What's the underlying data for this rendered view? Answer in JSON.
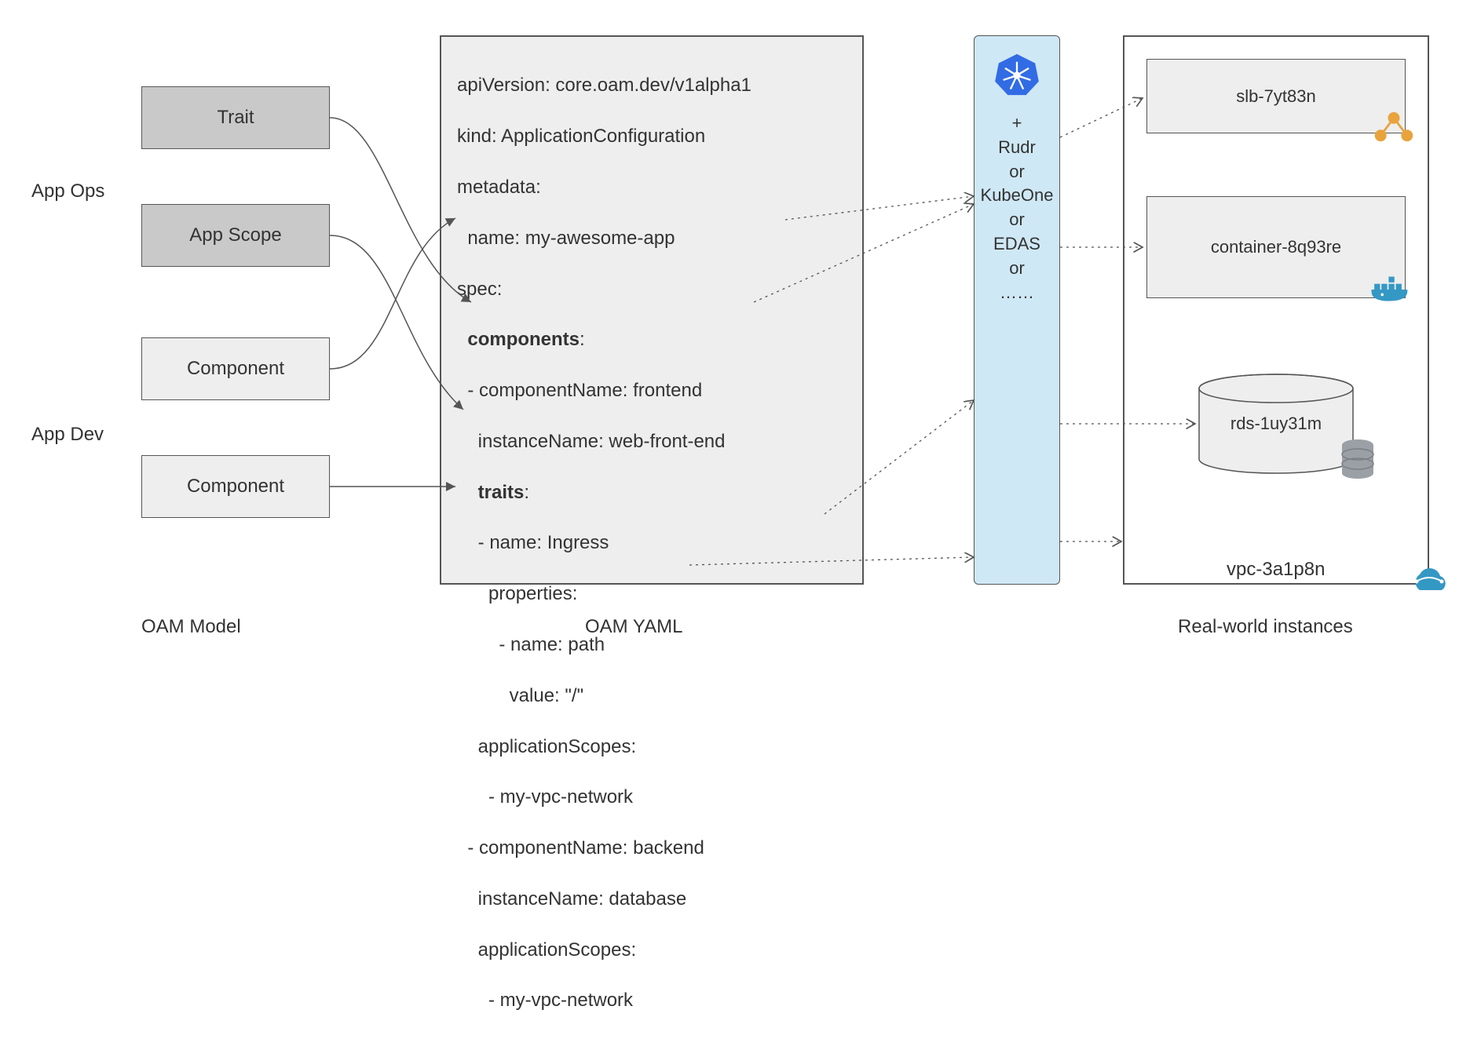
{
  "labels": {
    "app_ops": "App Ops",
    "app_dev": "App Dev",
    "oam_model": "OAM Model",
    "oam_yaml": "OAM YAML",
    "real_world": "Real-world instances"
  },
  "model": {
    "trait": "Trait",
    "app_scope": "App Scope",
    "component1": "Component",
    "component2": "Component"
  },
  "yaml": {
    "l1": "apiVersion: core.oam.dev/v1alpha1",
    "l2": "kind: ApplicationConfiguration",
    "l3": "metadata:",
    "l4": "  name: my-awesome-app",
    "l5": "spec:",
    "l6_b": "components",
    "l6_s": ":",
    "l7": "  - componentName: frontend",
    "l8": "    instanceName: web-front-end",
    "l9_b": "traits",
    "l9_s": ":",
    "l10": "    - name: Ingress",
    "l11": "      properties:",
    "l12": "        - name: path",
    "l13": "          value: \"/\"",
    "l14": "    applicationScopes:",
    "l15": "      - my-vpc-network",
    "l16": "  - componentName: backend",
    "l17": "    instanceName: database",
    "l18": "    applicationScopes:",
    "l19": "      - my-vpc-network"
  },
  "runtime": {
    "plus": "+",
    "line1": "Rudr",
    "line2": "or",
    "line3": "KubeOne",
    "line4": "or",
    "line5": "EDAS",
    "line6": "or",
    "line7": "……"
  },
  "instances": {
    "slb": "slb-7yt83n",
    "container": "container-8q93re",
    "rds": "rds-1uy31m",
    "vpc": "vpc-3a1p8n"
  }
}
